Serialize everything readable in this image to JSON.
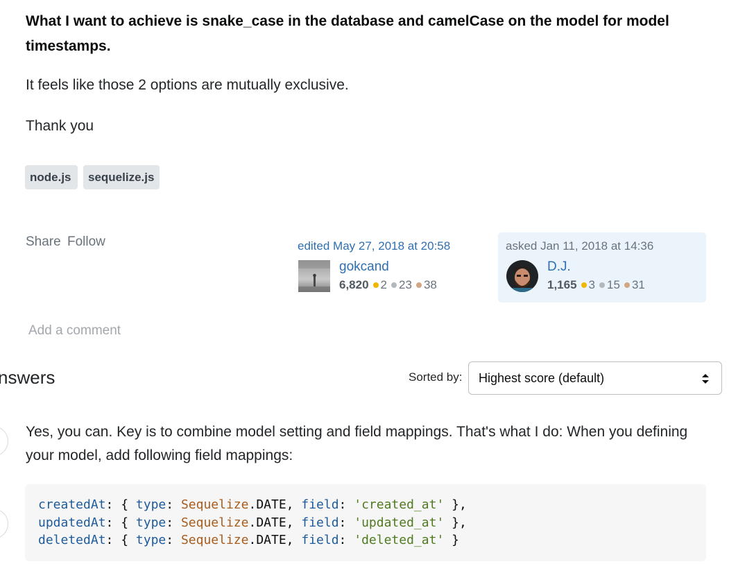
{
  "question": {
    "bold_line": "What I want to achieve is snake_case in the database and camelCase on the model for model timestamps.",
    "para1": "It feels like those 2 options are mutually exclusive.",
    "para2": "Thank you",
    "tags": [
      "node.js",
      "sequelize.js"
    ],
    "actions": {
      "share": "Share",
      "follow": "Follow"
    },
    "editor": {
      "label": "edited May 27, 2018 at 20:58",
      "name": "gokcand",
      "reputation": "6,820",
      "gold": "2",
      "silver": "23",
      "bronze": "38"
    },
    "asker": {
      "label": "asked Jan 11, 2018 at 14:36",
      "name": "D.J.",
      "reputation": "1,165",
      "gold": "3",
      "silver": "15",
      "bronze": "31"
    },
    "add_comment": "Add a comment"
  },
  "answers_header": {
    "title": "nswers",
    "sort_label": "Sorted by:",
    "sort_value": "Highest score (default)"
  },
  "answer": {
    "text": "Yes, you can. Key is to combine model setting and field mappings. That's what I do: When you defining your model, add following field mappings:",
    "code_lines": [
      [
        "createdAt",
        "type",
        "Sequelize",
        "DATE",
        "field",
        "'created_at'"
      ],
      [
        "updatedAt",
        "type",
        "Sequelize",
        "DATE",
        "field",
        "'updated_at'"
      ],
      [
        "deletedAt",
        "type",
        "Sequelize",
        "DATE",
        "field",
        "'deleted_at'"
      ]
    ]
  },
  "colors": {
    "link": "#2f6fb0",
    "gold": "#f1b600",
    "silver": "#b4b8bc",
    "bronze": "#d1a684",
    "asker_card_bg": "#ebf4fb",
    "tag_bg": "#e3e6e8"
  }
}
